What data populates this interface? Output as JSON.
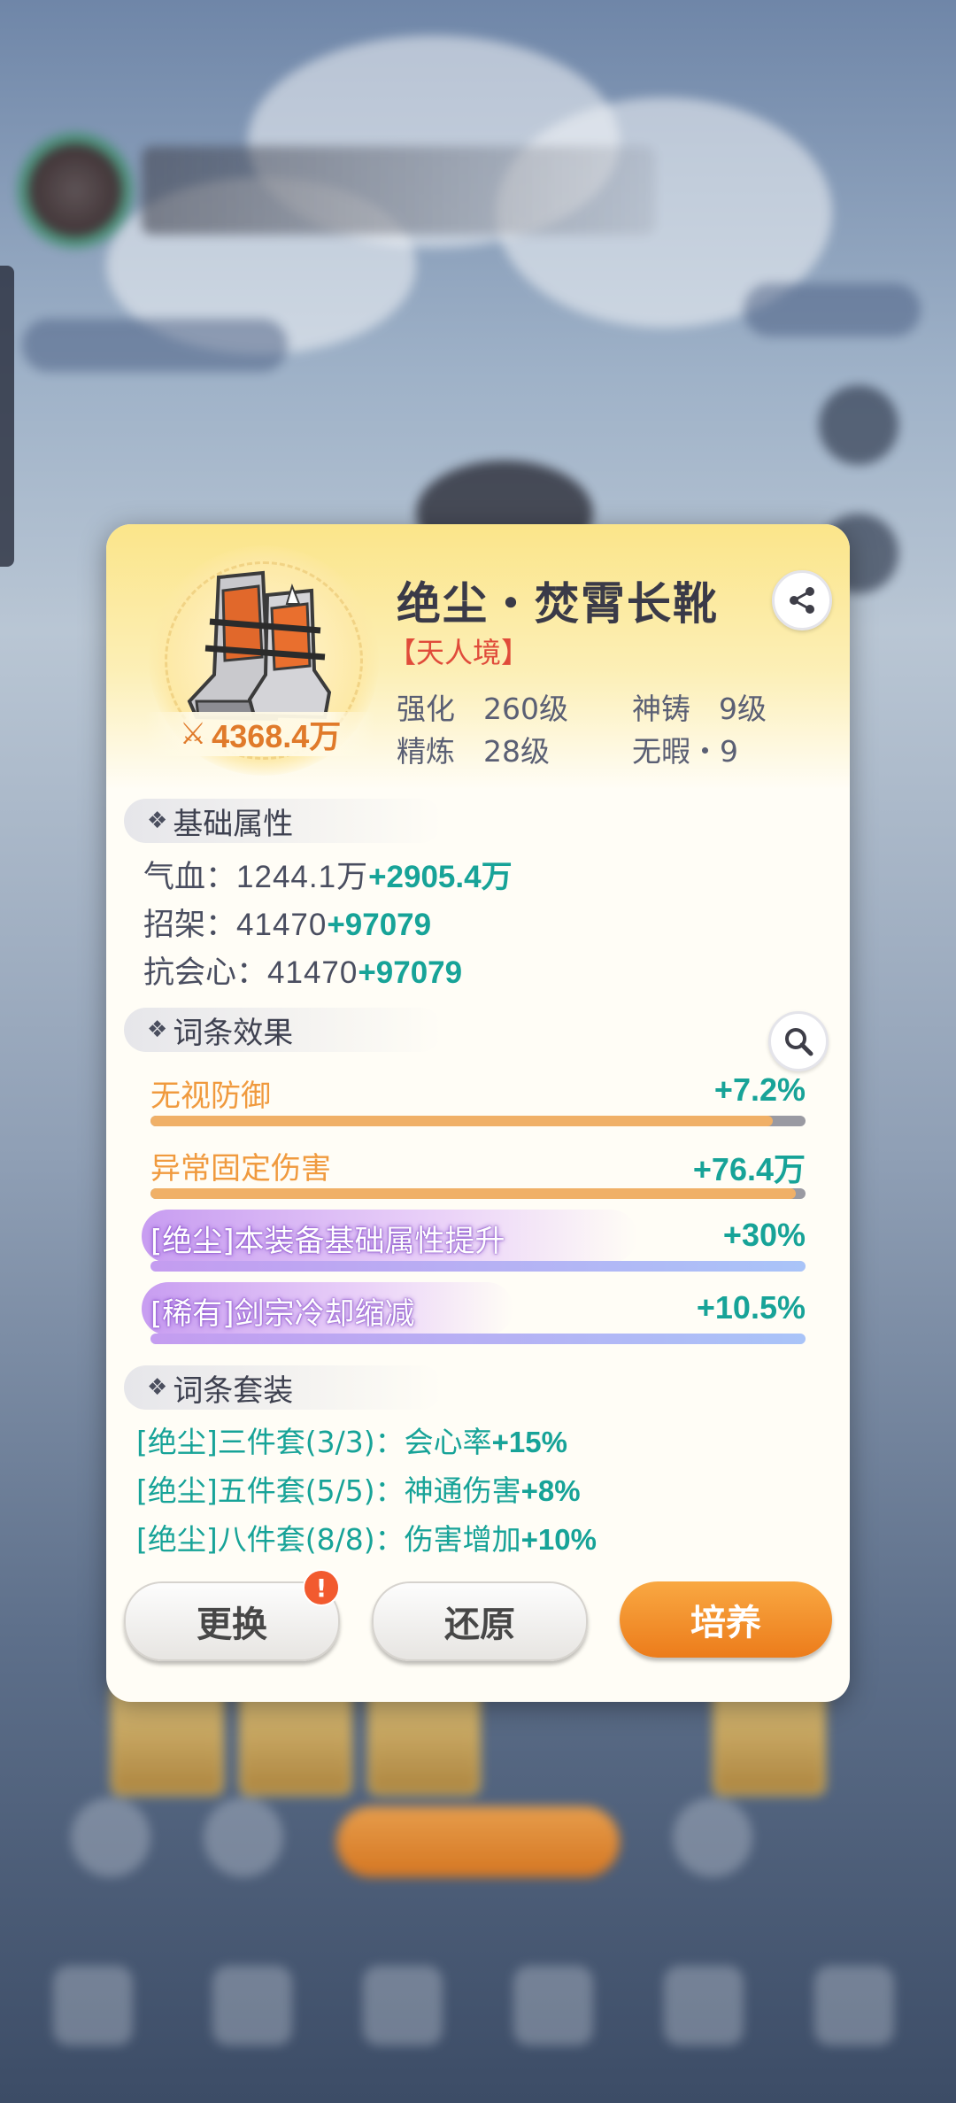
{
  "background": {
    "note_colors": {
      "panel_top": "#fbe58a",
      "accent_teal": "#17a398",
      "accent_orange": "#f09a3e",
      "realm_red": "#e04b3a"
    }
  },
  "item": {
    "icon": "boots-icon",
    "power_icon": "sword-power-icon",
    "power": "4368.4万",
    "name": "绝尘・焚霄长靴",
    "realm": "【天人境】",
    "share_icon": "share-icon",
    "stats": [
      {
        "key": "强化",
        "value": "260级"
      },
      {
        "key": "神铸",
        "value": "9级"
      },
      {
        "key": "精炼",
        "value": "28级"
      },
      {
        "key": "无暇・9",
        "value": ""
      }
    ]
  },
  "base": {
    "title": "基础属性",
    "attrs": [
      {
        "label": "气血：",
        "value": "1244.1万",
        "plus": "+2905.4万"
      },
      {
        "label": "招架：",
        "value": "41470",
        "plus": "+97079"
      },
      {
        "label": "抗会心：",
        "value": "41470",
        "plus": "+97079"
      }
    ]
  },
  "effects": {
    "title": "词条效果",
    "search_icon": "magnifier-icon",
    "items": [
      {
        "name": "无视防御",
        "value": "+7.2%",
        "fill": 0.95,
        "style": "orange"
      },
      {
        "name": "异常固定伤害",
        "value": "+76.4万",
        "fill": 0.985,
        "style": "orange"
      },
      {
        "name": "[绝尘]本装备基础属性提升",
        "value": "+30%",
        "fill": 1.0,
        "style": "purple"
      },
      {
        "name": "[稀有]剑宗冷却缩减",
        "value": "+10.5%",
        "fill": 1.0,
        "style": "purple"
      }
    ]
  },
  "sets": {
    "title": "词条套装",
    "items": [
      {
        "label": "[绝尘]三件套(3/3)：会心率",
        "plus": "+15%"
      },
      {
        "label": "[绝尘]五件套(5/5)：神通伤害",
        "plus": "+8%"
      },
      {
        "label": "[绝尘]八件套(8/8)：伤害增加",
        "plus": "+10%"
      }
    ]
  },
  "actions": {
    "replace": "更换",
    "replace_badge": "!",
    "restore": "还原",
    "cultivate": "培养"
  }
}
